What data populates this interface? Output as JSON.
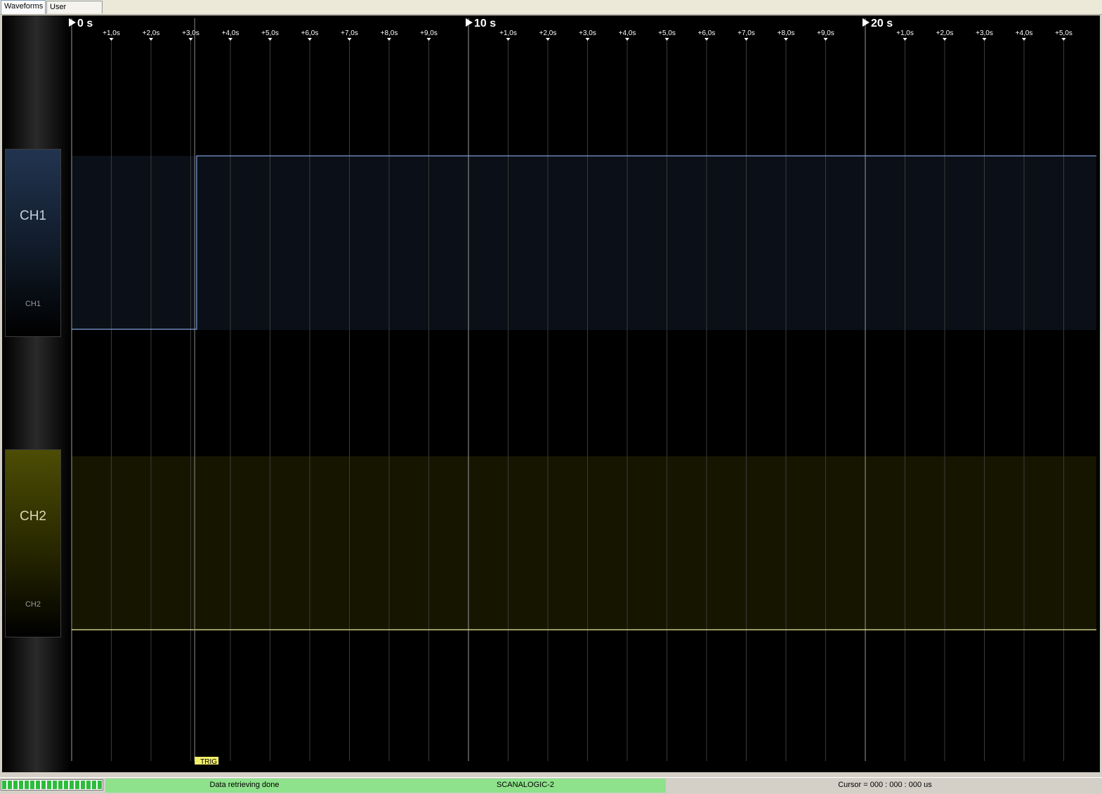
{
  "tabs": [
    {
      "label": "Waveforms",
      "active": true
    },
    {
      "label": "User comments",
      "active": false
    }
  ],
  "timeline": {
    "majors": [
      {
        "label": "0 s",
        "t": 0
      },
      {
        "label": "10 s",
        "t": 10
      },
      {
        "label": "20 s",
        "t": 20
      }
    ],
    "minor_labels": [
      "+1,0s",
      "+2,0s",
      "+3,0s",
      "+4,0s",
      "+5,0s",
      "+6,0s",
      "+7,0s",
      "+8,0s",
      "+9,0s"
    ],
    "visible_range_s": [
      0,
      25.8
    ],
    "trigger": {
      "label": "TRIG",
      "t": 3.1
    }
  },
  "channels": [
    {
      "id": "ch1",
      "name": "CH1",
      "sublabel": "CH1",
      "color": "#7e9bd4",
      "fill": "#0b1018",
      "edges": [
        {
          "t": 3.15,
          "level": 1
        }
      ],
      "initial_level": 0
    },
    {
      "id": "ch2",
      "name": "CH2",
      "sublabel": "CH2",
      "color": "#e8e8a0",
      "fill": "#161600",
      "edges": [],
      "initial_level": 0
    }
  ],
  "colors": {
    "background": "#000000",
    "grid": "#3a3a3a",
    "major_grid": "#9a9a9a",
    "trigger": "#f2ef6a",
    "status_ok": "#8ee28b"
  },
  "status": {
    "progress": 1.0,
    "message": "Data retrieving done",
    "device": "SCANALOGIC-2",
    "cursor": "Cursor = 000 : 000 : 000 us"
  }
}
